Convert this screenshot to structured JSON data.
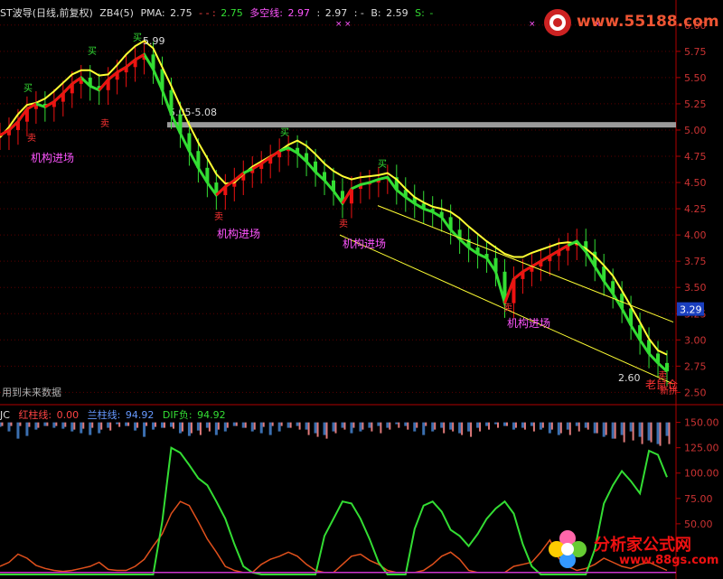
{
  "header": {
    "title": "ST波导(日线,前复权)",
    "indicator": "ZB4(5)",
    "pma_label": "PMA:",
    "pma_value": "2.75",
    "val2_label": "-  -  :",
    "val2_value": "2.75",
    "duokong_label": "多空线:",
    "duokong_value": "2.97",
    "val4_label": ":",
    "val4_value": "2.97",
    "val5_label": ":  -",
    "b_label": "B:",
    "b_value": "2.59",
    "s_label": "S:",
    "s_value": "-"
  },
  "sub_header": {
    "name": "JC",
    "red_label": "红柱线:",
    "red_value": "0.00",
    "blue_label": "兰柱线:",
    "blue_value": "94.92",
    "dif_label": "DIF负:",
    "dif_value": "94.92"
  },
  "future_note": "用到未来数据",
  "watermark_top": "www.55188.com",
  "watermark_bottom_cn": "分析家公式网",
  "watermark_bottom_url": "www.88gs.com",
  "colors": {
    "background": "#000000",
    "axis": "#b00000",
    "yellow": "#ffff33",
    "green": "#33dd33",
    "red": "#ee1111",
    "white": "#ffffff",
    "magenta": "#ff55ff",
    "blue_bar": "#3b6fb0",
    "pink_bar": "#e07a7a"
  },
  "chart_data": [
    {
      "type": "line",
      "name": "main",
      "ylim": [
        2.4,
        6.05
      ],
      "y_ticks": [
        2.5,
        2.75,
        3.0,
        3.25,
        3.5,
        3.75,
        4.0,
        4.25,
        4.5,
        4.75,
        5.0,
        5.25,
        5.5,
        5.75,
        6.0
      ],
      "y_tick_labels": [
        "2.50",
        "2.75",
        "3.00",
        "3.25",
        "3.50",
        "3.75",
        "4.00",
        "4.25",
        "4.50",
        "4.75",
        "5.00",
        "5.25",
        "5.50",
        "5.75",
        "6.00"
      ],
      "current_price": "3.29",
      "current_price_value": 3.29,
      "hline": {
        "value": 5.05,
        "label": "5.05-5.08"
      },
      "x": [
        0,
        10,
        20,
        30,
        40,
        50,
        60,
        70,
        80,
        90,
        100,
        110,
        120,
        130,
        140,
        150,
        160,
        170,
        180,
        190,
        200,
        210,
        220,
        230,
        240,
        250,
        260,
        270,
        280,
        290,
        300,
        310,
        320,
        330,
        340,
        350,
        360,
        370,
        380,
        390,
        400,
        410,
        420,
        430,
        440,
        450,
        460,
        470,
        480,
        490,
        500,
        510,
        520,
        530,
        540,
        550,
        560,
        570,
        580,
        590,
        600,
        610,
        620,
        630,
        640,
        650,
        660,
        670,
        680,
        690,
        700,
        710,
        720,
        730,
        740
      ],
      "series": [
        {
          "values": [
            4.93,
            5.03,
            5.15,
            5.24,
            5.26,
            5.3,
            5.37,
            5.45,
            5.53,
            5.57,
            5.57,
            5.52,
            5.53,
            5.62,
            5.72,
            5.8,
            5.85,
            5.78,
            5.6,
            5.42,
            5.23,
            5.05,
            4.88,
            4.73,
            4.58,
            4.49,
            4.5,
            4.58,
            4.65,
            4.7,
            4.75,
            4.8,
            4.86,
            4.9,
            4.85,
            4.77,
            4.68,
            4.61,
            4.56,
            4.53,
            4.55,
            4.56,
            4.57,
            4.59,
            4.53,
            4.44,
            4.36,
            4.31,
            4.27,
            4.25,
            4.22,
            4.16,
            4.08,
            4.01,
            3.94,
            3.88,
            3.82,
            3.79,
            3.79,
            3.83,
            3.86,
            3.89,
            3.92,
            3.93,
            3.92,
            3.87,
            3.8,
            3.71,
            3.61,
            3.47,
            3.32,
            3.17,
            3.01,
            2.9,
            2.86
          ]
        },
        {
          "values": [
            4.95,
            5.0,
            5.08,
            5.2,
            5.25,
            5.22,
            5.27,
            5.35,
            5.44,
            5.5,
            5.42,
            5.38,
            5.48,
            5.55,
            5.6,
            5.67,
            5.72,
            5.58,
            5.38,
            5.15,
            4.97,
            4.8,
            4.64,
            4.5,
            4.38,
            4.46,
            4.52,
            4.59,
            4.63,
            4.68,
            4.74,
            4.8,
            4.83,
            4.78,
            4.7,
            4.6,
            4.52,
            4.42,
            4.3,
            4.44,
            4.48,
            4.5,
            4.53,
            4.55,
            4.43,
            4.36,
            4.3,
            4.25,
            4.22,
            4.17,
            4.05,
            3.96,
            3.88,
            3.82,
            3.78,
            3.65,
            3.35,
            3.58,
            3.65,
            3.7,
            3.75,
            3.8,
            3.85,
            3.9,
            3.94,
            3.84,
            3.7,
            3.56,
            3.44,
            3.3,
            3.14,
            3.0,
            2.87,
            2.78,
            2.7
          ]
        }
      ],
      "annotations": [
        "机构进场",
        "机构进场",
        "机构进场",
        "机构进场",
        "卖",
        "卖",
        "卖",
        "卖",
        "卖",
        "卖",
        "买",
        "买",
        "买",
        "买",
        "买",
        "5.99",
        "2.60",
        "老鼠仓",
        "新拼"
      ]
    },
    {
      "type": "bar",
      "name": "JC",
      "ylim": [
        0,
        155
      ],
      "y_ticks": [
        50,
        75,
        100,
        125,
        150
      ],
      "y_tick_labels": [
        "50.00",
        "75.00",
        "100.00",
        "125.00",
        "150.00"
      ],
      "x": [
        0,
        10,
        20,
        30,
        40,
        50,
        60,
        70,
        80,
        90,
        100,
        110,
        120,
        130,
        140,
        150,
        160,
        170,
        180,
        190,
        200,
        210,
        220,
        230,
        240,
        250,
        260,
        270,
        280,
        290,
        300,
        310,
        320,
        330,
        340,
        350,
        360,
        370,
        380,
        390,
        400,
        410,
        420,
        430,
        440,
        450,
        460,
        470,
        480,
        490,
        500,
        510,
        520,
        530,
        540,
        550,
        560,
        570,
        580,
        590,
        600,
        610,
        620,
        630,
        640,
        650,
        660,
        670,
        680,
        690,
        700,
        710,
        720,
        730,
        740
      ],
      "series": [
        {
          "values": [
            5,
            10,
            18,
            15,
            8,
            4,
            6,
            7,
            10,
            12,
            14,
            12,
            6,
            2,
            4,
            9,
            16,
            8,
            6,
            5,
            12,
            15,
            9,
            6,
            14,
            10,
            4,
            6,
            10,
            12,
            14,
            10,
            6,
            4,
            8,
            12,
            14,
            10,
            6,
            12,
            10,
            6,
            4,
            6,
            2,
            4,
            10,
            14,
            10,
            6,
            8,
            12,
            10,
            6,
            4,
            2,
            4,
            8,
            6,
            4,
            8,
            12,
            14,
            8,
            4,
            6,
            12,
            16,
            18,
            14,
            10,
            16,
            20,
            24,
            15
          ]
        },
        {
          "values": [
            4,
            4,
            4,
            5,
            6,
            4,
            4,
            5,
            8,
            7,
            6,
            8,
            9,
            5,
            4,
            6,
            4,
            5,
            6,
            7,
            10,
            12,
            14,
            10,
            8,
            6,
            4,
            6,
            8,
            5,
            4,
            4,
            6,
            8,
            14,
            16,
            18,
            12,
            8,
            6,
            8,
            10,
            12,
            8,
            6,
            8,
            6,
            4,
            8,
            12,
            10,
            14,
            16,
            10,
            8,
            6,
            4,
            6,
            8,
            10,
            6,
            8,
            12,
            14,
            10,
            8,
            12,
            14,
            18,
            22,
            20,
            24,
            22,
            26,
            24
          ]
        },
        {
          "values": [
            8,
            12,
            20,
            16,
            9,
            6,
            4,
            3,
            4,
            6,
            8,
            12,
            5,
            4,
            4,
            8,
            15,
            28,
            40,
            60,
            72,
            68,
            52,
            35,
            22,
            8,
            4,
            2,
            2,
            10,
            15,
            18,
            22,
            18,
            10,
            4,
            2,
            2,
            10,
            18,
            20,
            14,
            10,
            4,
            2,
            2,
            2,
            4,
            10,
            18,
            22,
            15,
            4,
            2,
            2,
            2,
            2,
            8,
            10,
            12,
            22,
            34,
            16,
            8,
            4,
            6,
            10,
            16,
            12,
            8,
            6,
            10,
            12,
            8,
            4
          ]
        },
        {
          "values": [
            0,
            0,
            0,
            0,
            0,
            0,
            0,
            0,
            0,
            0,
            0,
            0,
            0,
            0,
            0,
            0,
            0,
            0,
            52,
            125,
            120,
            108,
            95,
            88,
            72,
            55,
            30,
            8,
            2,
            0,
            0,
            0,
            0,
            0,
            0,
            0,
            38,
            55,
            72,
            70,
            55,
            35,
            12,
            0,
            0,
            0,
            45,
            68,
            72,
            62,
            44,
            38,
            28,
            40,
            55,
            65,
            72,
            60,
            30,
            8,
            0,
            0,
            0,
            0,
            0,
            0,
            25,
            70,
            88,
            102,
            92,
            80,
            122,
            118,
            96
          ]
        }
      ]
    }
  ]
}
